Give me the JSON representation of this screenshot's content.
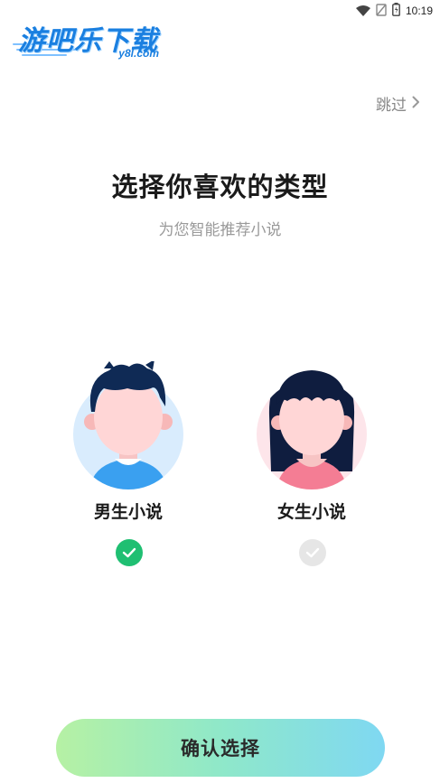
{
  "status_bar": {
    "time": "10:19"
  },
  "watermark": {
    "brand": "游吧乐下载",
    "domain": "y8l.com"
  },
  "header": {
    "skip_label": "跳过"
  },
  "main": {
    "title": "选择你喜欢的类型",
    "subtitle": "为您智能推荐小说"
  },
  "choices": [
    {
      "label": "男生小说",
      "selected": true
    },
    {
      "label": "女生小说",
      "selected": false
    }
  ],
  "footer": {
    "confirm_label": "确认选择"
  },
  "colors": {
    "selected_check": "#1fbf72",
    "unselected_check": "#e6e6e6",
    "male_bg": "#d9ecfd",
    "female_bg": "#fde5ea",
    "button_gradient_start": "#b6f1a4",
    "button_gradient_end": "#7fd8f2"
  }
}
